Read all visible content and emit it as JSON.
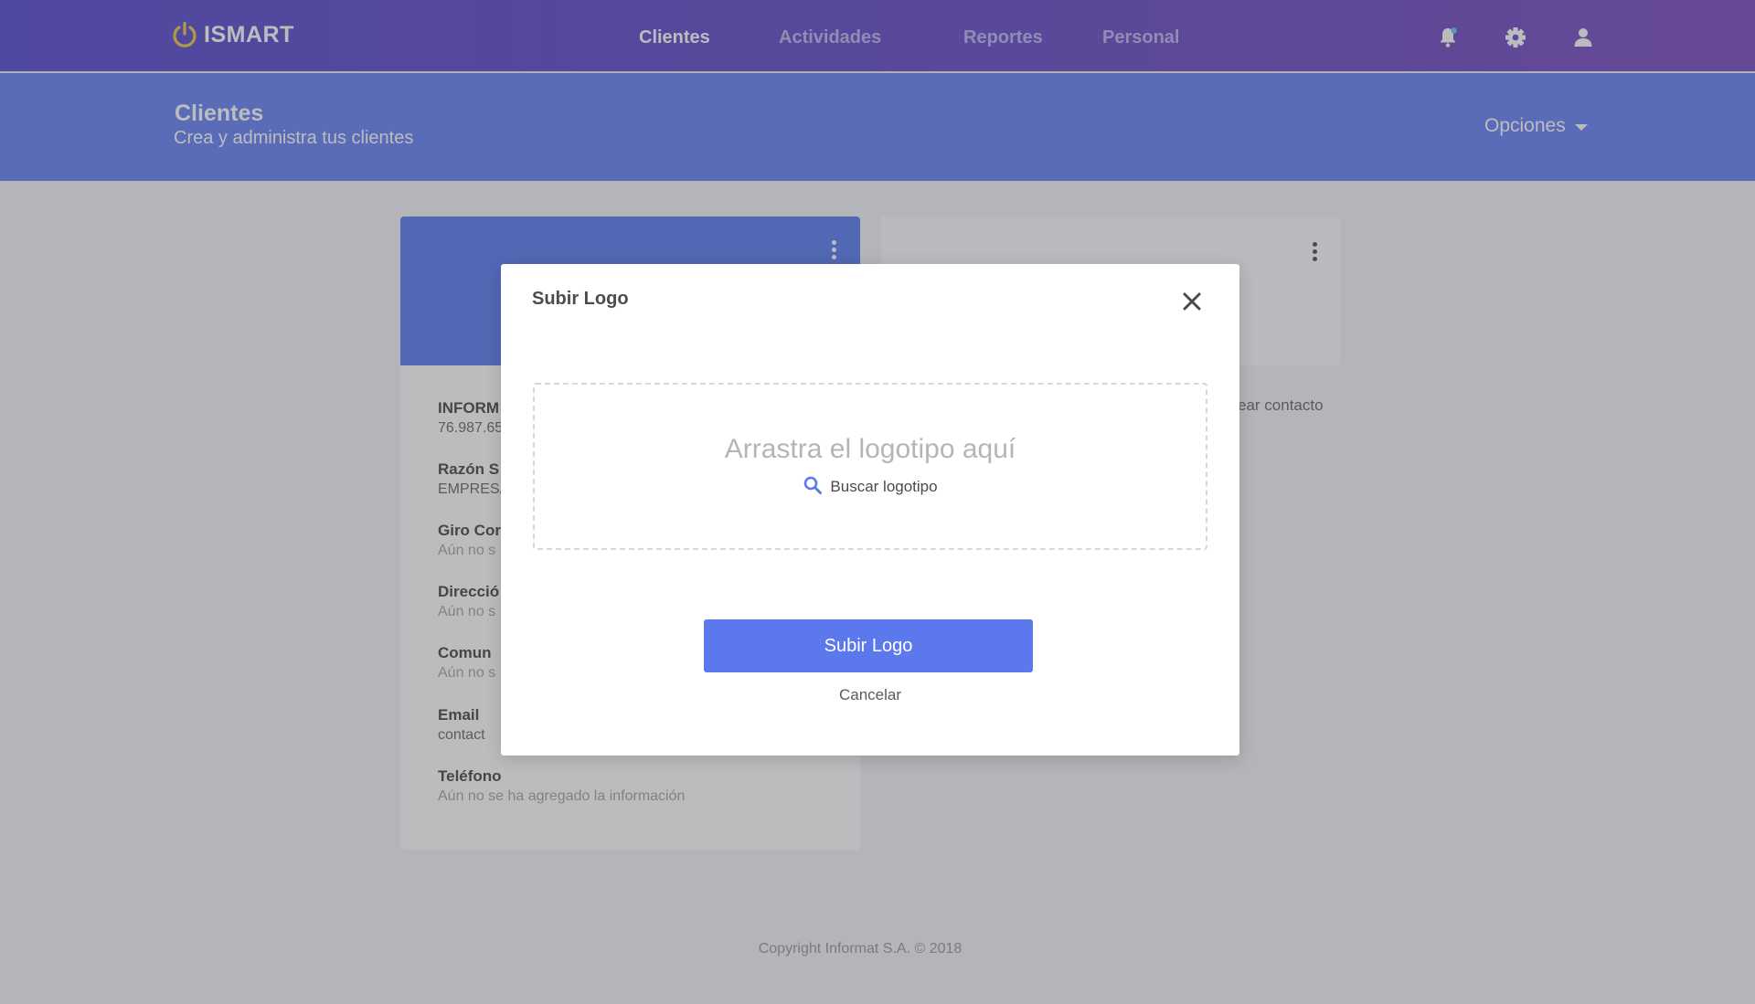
{
  "nav": {
    "brand": "ISMART",
    "links": [
      {
        "label": "Clientes",
        "active": true
      },
      {
        "label": "Actividades",
        "active": false
      },
      {
        "label": "Reportes",
        "active": false
      },
      {
        "label": "Personal",
        "active": false
      }
    ],
    "icons": [
      "bell-icon",
      "gear-icon",
      "user-icon"
    ]
  },
  "subheader": {
    "title": "Clientes",
    "subtitle": "Crea y administra tus clientes",
    "options_label": "Opciones"
  },
  "client_card": {
    "fields": [
      {
        "label": "INFORM",
        "value": "76.987.65",
        "muted": false
      },
      {
        "label": "Razón S",
        "value": "EMPRESA",
        "muted": false
      },
      {
        "label": "Giro Cor",
        "value": "Aún no s",
        "muted": true
      },
      {
        "label": "Direcció",
        "value": "Aún no s",
        "muted": true
      },
      {
        "label": "Comun",
        "value": "Aún no s",
        "muted": true
      },
      {
        "label": "Email",
        "value": "contact",
        "muted": false
      },
      {
        "label": "Teléfono",
        "value": "Aún no se ha agregado la información",
        "muted": true
      }
    ]
  },
  "contact_card": {
    "link_text": "ear  contacto"
  },
  "footer": {
    "copyright": "Copyright Informat S.A. © 2018"
  },
  "modal": {
    "title": "Subir Logo",
    "dropzone_text": "Arrastra el logotipo aquí",
    "browse_label": "Buscar logotipo",
    "submit_label": "Subir Logo",
    "cancel_label": "Cancelar"
  },
  "colors": {
    "nav_gradient_start": "#5a4fd0",
    "nav_gradient_end": "#7d4fc2",
    "subheader_bg": "#6b85f5",
    "primary_button": "#5b79ec",
    "logo_yellow": "#f2c94c"
  }
}
